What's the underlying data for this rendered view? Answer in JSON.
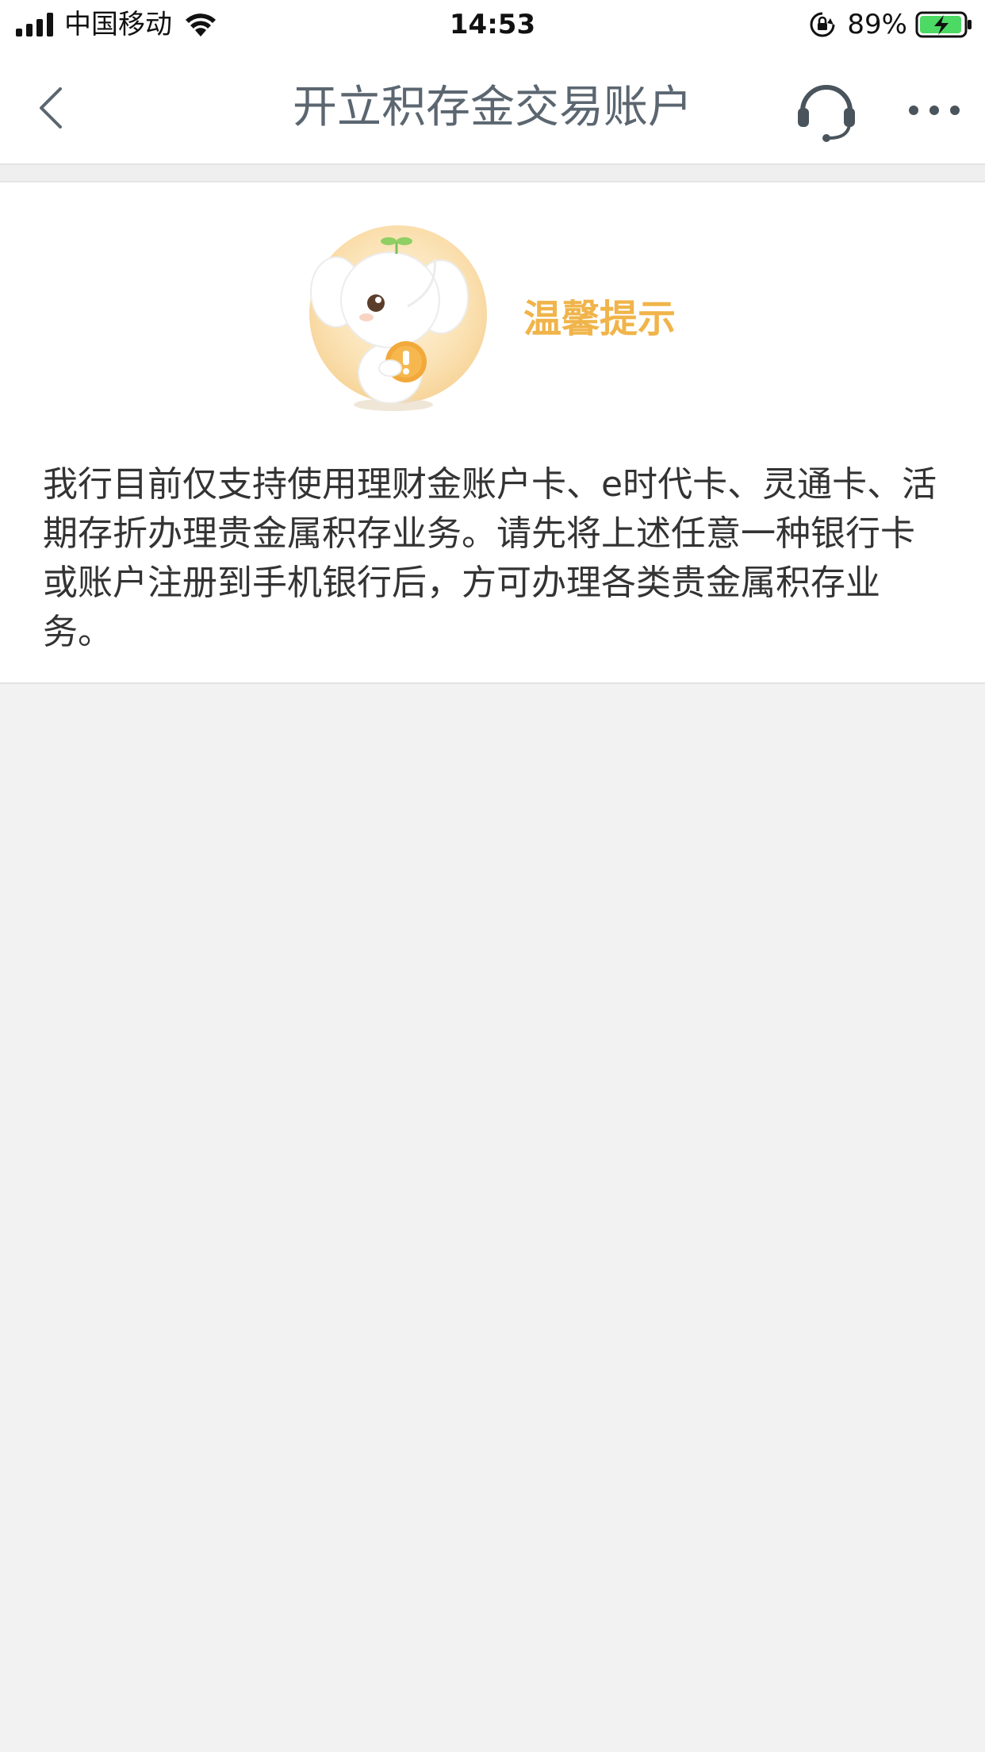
{
  "status_bar": {
    "carrier": "中国移动",
    "time": "14:53",
    "battery_percent": "89%",
    "icons": [
      "signal-icon",
      "wifi-icon",
      "rotation-lock-icon",
      "battery-charging-icon"
    ]
  },
  "nav": {
    "title": "开立积存金交易账户",
    "icons": [
      "back-arrow-icon",
      "headset-icon",
      "more-dots-icon"
    ]
  },
  "notice": {
    "title": "温馨提示",
    "body": "我行目前仅支持使用理财金账户卡、e时代卡、灵通卡、活期存折办理贵金属积存业务。请先将上述任意一种银行卡或账户注册到手机银行后，方可办理各类贵金属积存业务。",
    "mascot_icon": "elephant-mascot-icon"
  },
  "colors": {
    "accent": "#f0b44a",
    "title_gray": "#5b6670",
    "background": "#f2f2f2"
  }
}
